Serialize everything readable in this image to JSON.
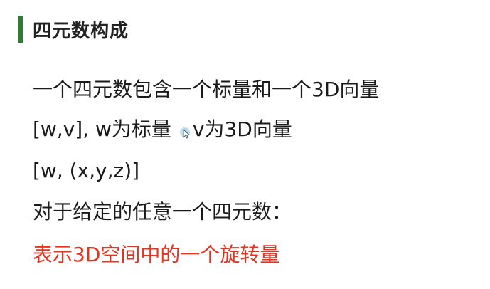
{
  "heading": {
    "title": "四元数构成",
    "accent_color": "#2e7d32"
  },
  "lines": {
    "line1": "一个四元数包含一个标量和一个3D向量",
    "line2_part1": "[w,v], w为标量",
    "line2_part2": "v为3D向量",
    "line3": "[w, (x,y,z)]",
    "line4": "对于给定的任意一个四元数：",
    "line5": "表示3D空间中的一个旋转量",
    "line5_color": "#e8321e"
  },
  "cursor": {
    "icon": "mouse-pointer-icon"
  }
}
